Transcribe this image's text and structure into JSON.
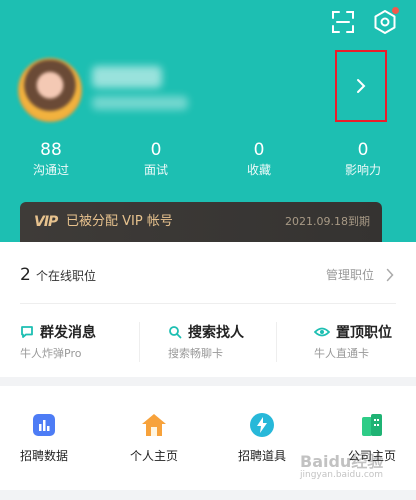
{
  "header": {
    "icons": {
      "scan": "scan-icon",
      "settings": "settings-icon"
    },
    "colors": {
      "hero_bg": "#1dbfb2",
      "notification_dot": "#f05a4e",
      "highlight_box": "#ec1d2a"
    }
  },
  "stats": [
    {
      "value": "88",
      "label": "沟通过"
    },
    {
      "value": "0",
      "label": "面试"
    },
    {
      "value": "0",
      "label": "收藏"
    },
    {
      "value": "0",
      "label": "影响力"
    }
  ],
  "vip": {
    "logo": "VIP",
    "text": "已被分配 VIP 帐号",
    "expiry": "2021.09.18到期",
    "colors": {
      "bg": "#3e3b38",
      "gold": "#e7c28e"
    }
  },
  "jobs": {
    "count": "2",
    "label": "个在线职位",
    "manage": "管理职位"
  },
  "actions": [
    {
      "title": "群发消息",
      "subtitle": "牛人炸弹Pro",
      "icon": "chat-icon"
    },
    {
      "title": "搜索找人",
      "subtitle": "搜索畅聊卡",
      "icon": "search-icon"
    },
    {
      "title": "置顶职位",
      "subtitle": "牛人直通卡",
      "icon": "eye-icon"
    }
  ],
  "tools": [
    {
      "label": "招聘数据",
      "icon": "chart-icon"
    },
    {
      "label": "个人主页",
      "icon": "home-icon"
    },
    {
      "label": "招聘道具",
      "icon": "lightning-icon"
    },
    {
      "label": "公司主页",
      "icon": "building-icon"
    }
  ],
  "watermark": {
    "text": "Baidu经验",
    "url": "jingyan.baidu.com"
  }
}
